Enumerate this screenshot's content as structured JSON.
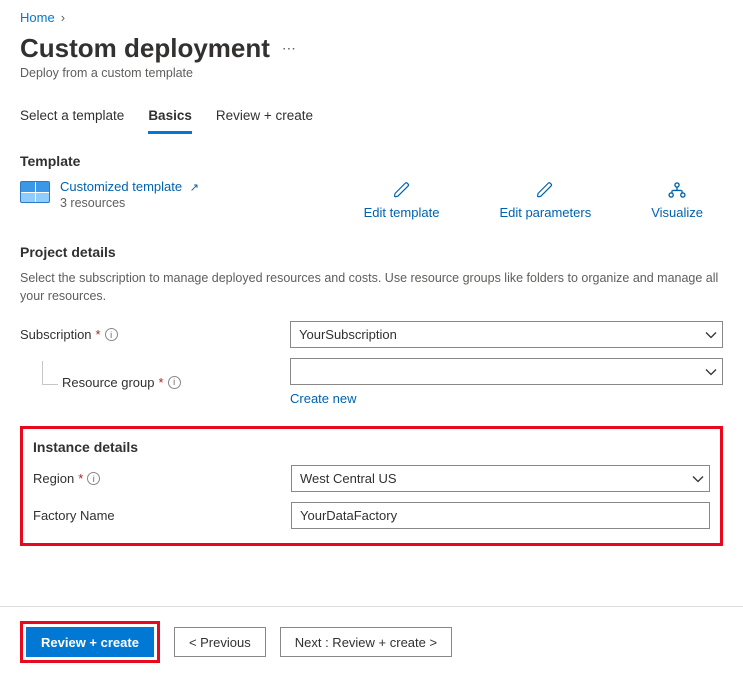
{
  "breadcrumb": {
    "home": "Home"
  },
  "header": {
    "title": "Custom deployment",
    "subtitle": "Deploy from a custom template"
  },
  "tabs": {
    "select": "Select a template",
    "basics": "Basics",
    "review": "Review + create"
  },
  "template": {
    "section_title": "Template",
    "link_text": "Customized template",
    "resource_count": "3 resources"
  },
  "actions": {
    "edit_template": "Edit template",
    "edit_parameters": "Edit parameters",
    "visualize": "Visualize"
  },
  "project": {
    "section_title": "Project details",
    "description": "Select the subscription to manage deployed resources and costs. Use resource groups like folders to organize and manage all your resources.",
    "subscription_label": "Subscription",
    "subscription_value": "YourSubscription",
    "resource_group_label": "Resource group",
    "resource_group_value": "",
    "create_new": "Create new"
  },
  "instance": {
    "section_title": "Instance details",
    "region_label": "Region",
    "region_value": "West Central US",
    "factory_label": "Factory Name",
    "factory_value": "YourDataFactory"
  },
  "footer": {
    "review_create": "Review + create",
    "previous": "< Previous",
    "next": "Next : Review + create >"
  }
}
